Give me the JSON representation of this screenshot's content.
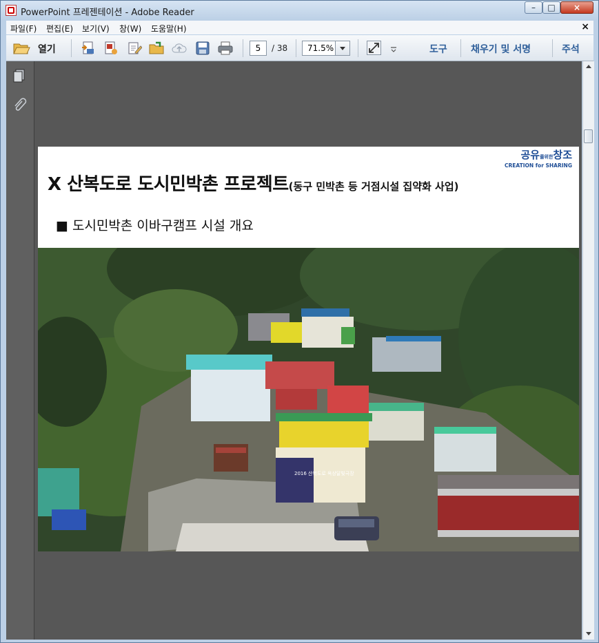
{
  "window": {
    "title": "PowerPoint 프레젠테이션 - Adobe Reader",
    "minimize": "–",
    "maximize": "□",
    "close": "×"
  },
  "menu": {
    "items": [
      "파일(F)",
      "편집(E)",
      "보기(V)",
      "창(W)",
      "도움말(H)"
    ],
    "close": "×"
  },
  "toolbar": {
    "open_label": "열기",
    "page_current": "5",
    "page_total": "/ 38",
    "zoom": "71.5%",
    "tools_label": "도구",
    "fill_sign_label": "채우기 및 서명",
    "comment_label": "주석"
  },
  "slide": {
    "title": "X 산복도로 도시민박촌 프로젝트",
    "subtitle": "(동구 민박촌 등 거점시설 집약화 사업)",
    "bullet": "■ 도시민박촌 이바구캠프 시설 개요",
    "logo_main_1": "공유",
    "logo_small": "를위한",
    "logo_main_2": "창조",
    "logo_sub": "CREATION for SHARING",
    "banner_text": "2016 산복도로 옥상달빛극장"
  },
  "colors": {
    "logo_blue": "#1f4e96",
    "tool_blue": "#2f5f9a",
    "doc_bg": "#575757"
  }
}
